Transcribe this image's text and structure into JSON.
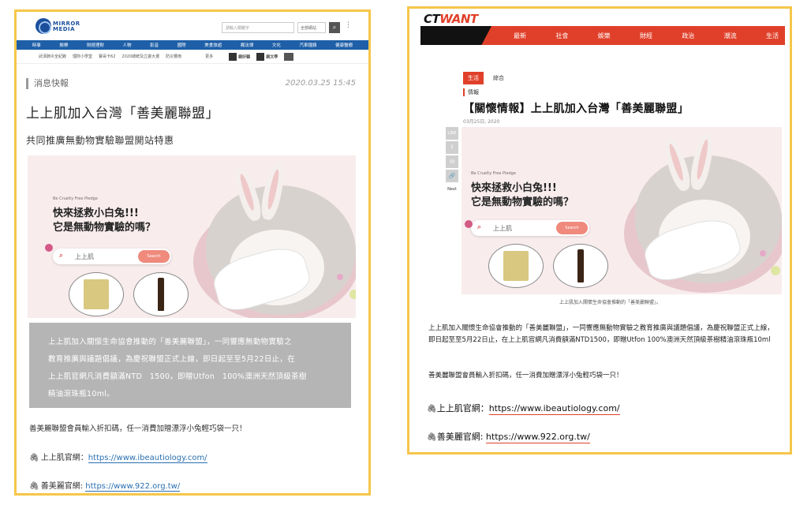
{
  "left": {
    "site": {
      "logo_text": "MIRROR MEDIA",
      "search_placeholder": "請輸入關鍵字",
      "search_select": "全部網站",
      "nav": [
        "時事",
        "娛樂",
        "財經理財",
        "人物",
        "影音",
        "國際",
        "美食旅遊",
        "瘋法律",
        "文化",
        "汽車鐘錶",
        "健康醫療"
      ],
      "subnav": [
        "武漢肺炎全紀錄",
        "理財小學堂",
        "寶哥卡62",
        "2020總統及立委大選",
        "防災豐南",
        "更多"
      ],
      "partners": [
        "鏡好聽",
        "鏡文學"
      ]
    },
    "article": {
      "category": "消息快報",
      "date": "2020.03.25 15:45",
      "title": "上上肌加入台灣「善美麗聯盟」",
      "subtitle": "共同推廣無動物實驗聯盟開站特惠",
      "highlight_lines": [
        "上上肌加入關懷生命協會推動的「善美麗聯盟」，一同響應無動物實驗之",
        "教育推廣與議題倡議，為慶祝聯盟正式上線，即日起至至5月22日止，在",
        "上上肌官網凡消費額滿NTD　1500，即贈Utfon　100%澳洲天然頂級茶樹",
        "精油滾珠瓶10ml。"
      ],
      "paragraph": "善美麗聯盟會員輸入折扣碼，任一消費加贈漂浮小兔輕巧袋一只！",
      "links": [
        {
          "label": "上上肌官網：",
          "url": "https://www.ibeautiology.com/"
        },
        {
          "label": "善美麗官網: ",
          "url": "https://www.922.org.tw/"
        }
      ]
    },
    "hero": {
      "pledge": "Be Cruelty Free Pledge",
      "headline_1": "快來拯救小白兔!!!",
      "headline_2": "它是無動物實驗的嗎？",
      "search_keyword": "上上肌",
      "search_button": "Search"
    }
  },
  "right": {
    "site": {
      "logo_ct": "CT",
      "logo_want": "WANT",
      "nav": [
        "最新",
        "社會",
        "娛樂",
        "財經",
        "政治",
        "潮流",
        "生活"
      ]
    },
    "article": {
      "tag_primary": "生活",
      "tag_secondary": "綜合",
      "info_label": "情報",
      "title": "【關懷情報】上上肌加入台灣「善美麗聯盟」",
      "date": "03月25日, 2020",
      "share": {
        "line": "LINE",
        "facebook": "f",
        "wechat": "✉",
        "link": "🔗",
        "next": "Next"
      },
      "caption": "上上肌加入關懷生命協會推動的「善美麗聯盟」。",
      "body": "上上肌加入關懷生命協會推動的「善美麗聯盟」，一同響應無動物實驗之教育推廣與議題倡議，為慶祝聯盟正式上線，即日起至至5月22日止，在上上肌官網凡消費額滿NTD1500，即贈Utfon 100%澳洲天然頂級茶樹精油滾珠瓶10ml",
      "body2": "善美麗聯盟會員輸入折扣碼，任一消費加贈漂浮小兔輕巧袋一只！",
      "links": [
        {
          "label": "上上肌官網：",
          "url": "https://www.ibeautiology.com/"
        },
        {
          "label": "善美麗官網: ",
          "url": "https://www.922.org.tw/"
        }
      ]
    },
    "hero": {
      "pledge": "Be Cruelty Free Pledge",
      "headline_1": "快來拯救小白兔!!!",
      "headline_2": "它是無動物實驗的嗎？",
      "search_keyword": "上上肌",
      "search_button": "Search"
    }
  },
  "colors": {
    "border": "#f6c64a",
    "mm_blue": "#1e5fa8",
    "ct_red": "#e0402a",
    "hero_bg": "#f8eced"
  }
}
